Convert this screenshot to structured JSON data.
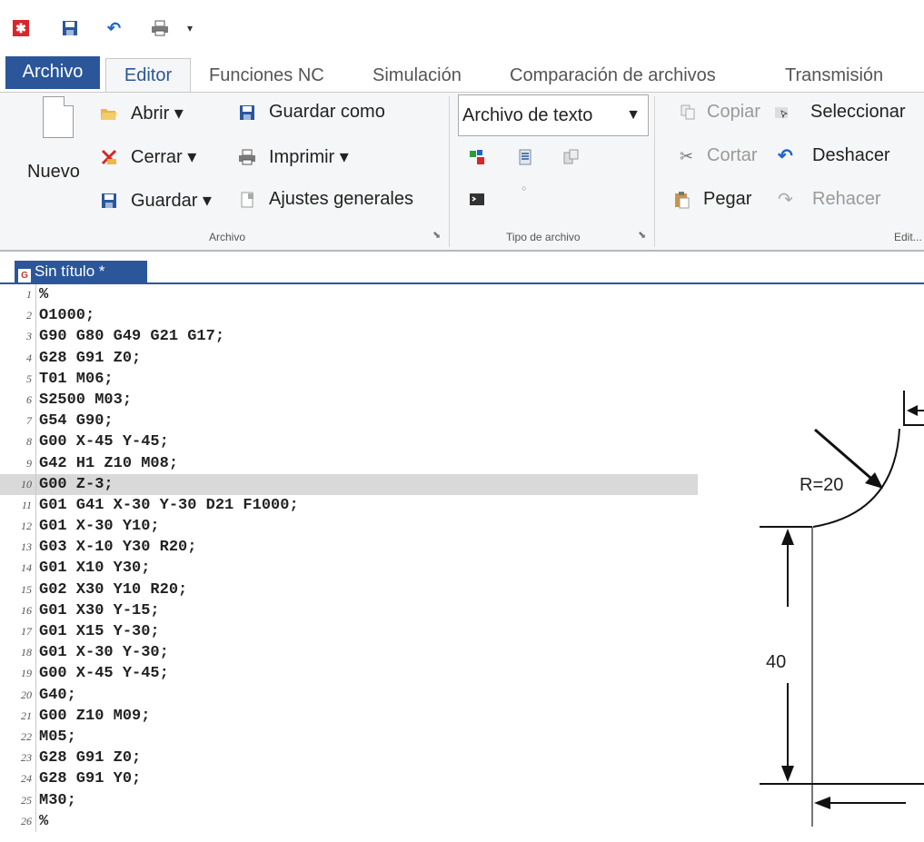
{
  "ribbon_tabs": {
    "file": "Archivo",
    "editor": "Editor",
    "nc_functions": "Funciones NC",
    "simulation": "Simulación",
    "file_comparison": "Comparación de archivos",
    "transmission": "Transmisión"
  },
  "archivo_group": {
    "new": "Nuevo",
    "open": "Abrir ▾",
    "close": "Cerrar ▾",
    "save": "Guardar ▾",
    "save_as": "Guardar como",
    "print": "Imprimir ▾",
    "general_settings": "Ajustes generales",
    "label": "Archivo"
  },
  "tipo_group": {
    "file_type_value": "Archivo de texto",
    "label": "Tipo de archivo"
  },
  "edit_group": {
    "copy": "Copiar",
    "select": "Seleccionar",
    "cut": "Cortar",
    "undo": "Deshacer",
    "paste": "Pegar",
    "redo": "Rehacer",
    "label": "Edit..."
  },
  "document_tab": "Sin título *",
  "code_lines": [
    "%",
    "O1000;",
    "G90 G80 G49 G21 G17;",
    "G28 G91 Z0;",
    "T01 M06;",
    "S2500 M03;",
    "G54 G90;",
    "G00 X-45 Y-45;",
    "G42 H1 Z10 M08;",
    "G00 Z-3;",
    "G01 G41 X-30 Y-30 D21 F1000;",
    "G01 X-30 Y10;",
    "G03 X-10 Y30 R20;",
    "G01 X10 Y30;",
    "G02 X30 Y10 R20;",
    "G01 X30 Y-15;",
    "G01 X15 Y-30;",
    "G01 X-30 Y-30;",
    "G00 X-45 Y-45;",
    "G40;",
    "G00 Z10 M09;",
    "M05;",
    "G28 G91 Z0;",
    "G28 G91 Y0;",
    "M30;",
    "%"
  ],
  "highlighted_line": 10,
  "drawing": {
    "radius_label": "R=20",
    "dimension_label": "40"
  }
}
